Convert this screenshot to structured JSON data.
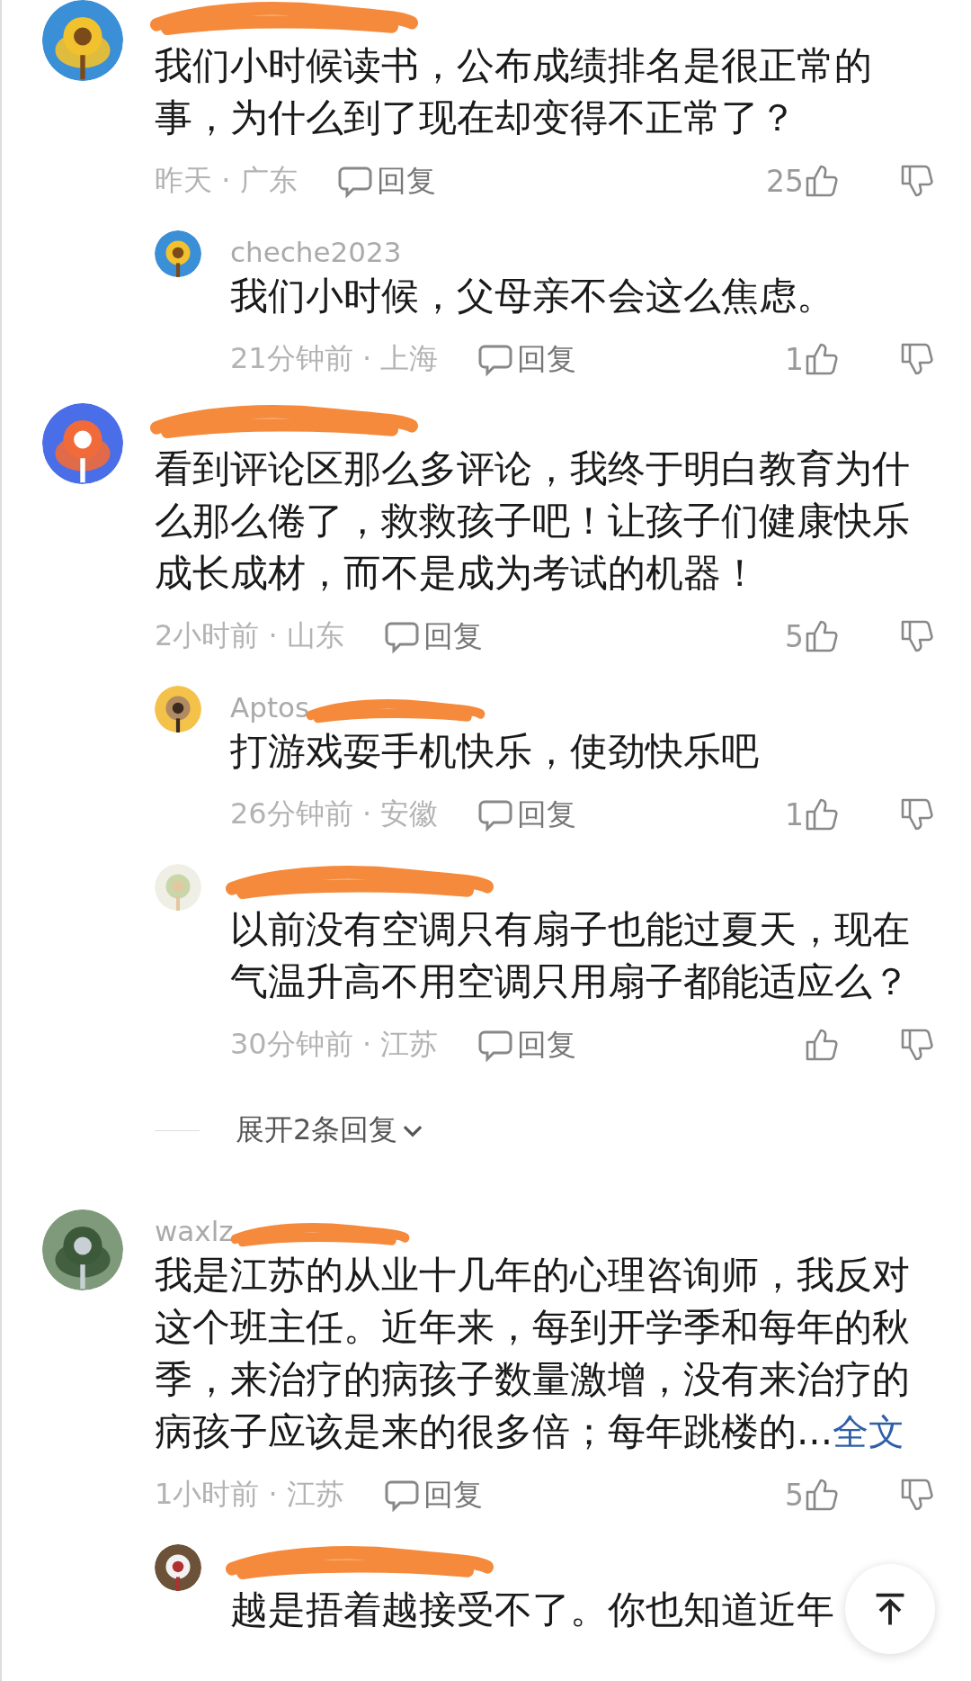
{
  "comments": [
    {
      "redacted": true,
      "text": "我们小时候读书，公布成绩排名是很正常的事，为什么到了现在却变得不正常了？",
      "meta": "昨天 · 广东",
      "reply_label": "回复",
      "likes": "25",
      "replies": [
        {
          "author": "cheche2023",
          "text": "我们小时候，父母亲不会这么焦虑。",
          "meta": "21分钟前 · 上海",
          "reply_label": "回复",
          "likes": "1"
        }
      ]
    },
    {
      "redacted": true,
      "text": "看到评论区那么多评论，我终于明白教育为什么那么倦了，救救孩子吧！让孩子们健康快乐成长成材，而不是成为考试的机器！",
      "meta": "2小时前 · 山东",
      "reply_label": "回复",
      "likes": "5",
      "replies": [
        {
          "author": "Aptos",
          "redacted": true,
          "text": "打游戏耍手机快乐，使劲快乐吧",
          "meta": "26分钟前 · 安徽",
          "reply_label": "回复",
          "likes": "1"
        },
        {
          "redacted": true,
          "text": "以前没有空调只有扇子也能过夏天，现在气温升高不用空调只用扇子都能适应么？",
          "meta": "30分钟前 · 江苏",
          "reply_label": "回复"
        }
      ],
      "expand": "展开2条回复"
    },
    {
      "author": "waxlz",
      "redacted": true,
      "text": "我是江苏的从业十几年的心理咨询师，我反对这个班主任。近年来，每到开学季和每年的秋季，来治疗的病孩子数量激增，没有来治疗的病孩子应该是来的很多倍；每年跳楼的...",
      "more_link": "全文",
      "meta": "1小时前 · 江苏",
      "reply_label": "回复",
      "likes": "5",
      "replies": [
        {
          "redacted": true,
          "text": "越是捂着越接受不了。你也知道近年"
        }
      ]
    }
  ]
}
